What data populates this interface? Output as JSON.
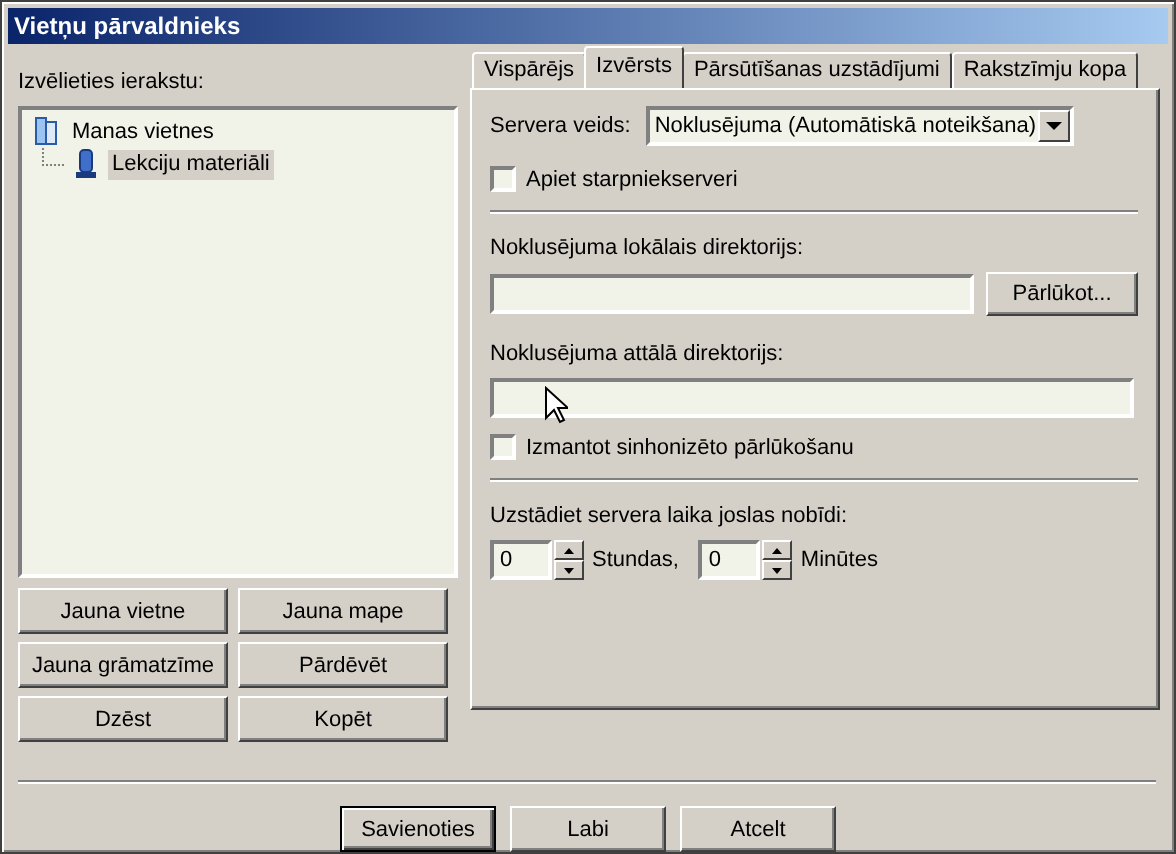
{
  "window": {
    "title": "Vietņu pārvaldnieks"
  },
  "entries_label": "Izvēlieties ierakstu:",
  "tree": [
    {
      "label": "Manas vietnes",
      "kind": "folder",
      "selected": false,
      "children": [
        {
          "label": "Lekciju materiāli",
          "kind": "site",
          "selected": true
        }
      ]
    }
  ],
  "left_buttons": [
    "Jauna vietne",
    "Jauna mape",
    "Jauna grāmatzīme",
    "Pārdēvēt",
    "Dzēst",
    "Kopēt"
  ],
  "tabs": [
    {
      "label": "Vispārējs",
      "selected": false
    },
    {
      "label": "Izvērsts",
      "selected": true
    },
    {
      "label": "Pārsūtīšanas uzstādījumi",
      "selected": false
    },
    {
      "label": "Rakstzīmju kopa",
      "selected": false
    }
  ],
  "advanced": {
    "server_type": {
      "label": "Servera veids:",
      "value": "Noklusējuma (Automātiskā noteikšana)"
    },
    "bypass_proxy": {
      "label": "Apiet starpniekserveri",
      "checked": false
    },
    "local_dir": {
      "label": "Noklusējuma lokālais direktorijs:",
      "browse": "Pārlūkot..."
    },
    "remote_dir": {
      "label": "Noklusējuma attālā direktorijs:"
    },
    "sync_browsing": {
      "label": "Izmantot sinhonizēto pārlūkošanu",
      "checked": false
    },
    "timezone": {
      "label": "Uzstādiet servera laika joslas nobīdi:",
      "hours": {
        "value": "0",
        "unit": "Stundas,"
      },
      "minutes": {
        "value": "0",
        "unit": "Minūtes"
      }
    }
  },
  "buttons": [
    {
      "label": "Savienoties",
      "default": true
    },
    {
      "label": "Labi",
      "default": false
    },
    {
      "label": "Atcelt",
      "default": false
    }
  ]
}
